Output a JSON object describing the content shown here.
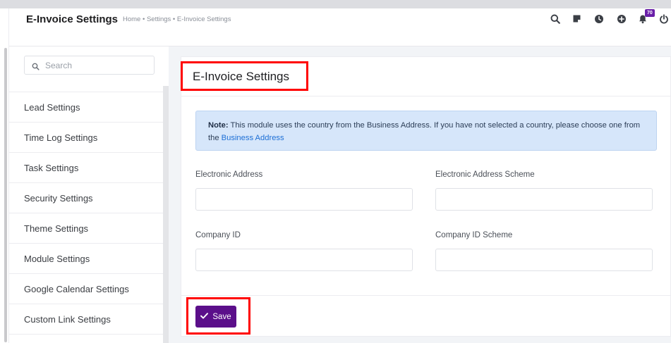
{
  "header": {
    "title": "E-Invoice Settings",
    "breadcrumb": "Home • Settings • E-Invoice Settings",
    "notification_count": "70",
    "icons": [
      "search-icon",
      "sticky-note-icon",
      "clock-icon",
      "plus-circle-icon",
      "bell-icon",
      "power-icon"
    ]
  },
  "sidebar": {
    "search_placeholder": "Search",
    "items": [
      {
        "label": "Lead Settings"
      },
      {
        "label": "Time Log Settings"
      },
      {
        "label": "Task Settings"
      },
      {
        "label": "Security Settings"
      },
      {
        "label": "Theme Settings"
      },
      {
        "label": "Module Settings"
      },
      {
        "label": "Google Calendar Settings"
      },
      {
        "label": "Custom Link Settings"
      }
    ]
  },
  "main": {
    "card_title": "E-Invoice Settings",
    "note": {
      "prefix": "Note:",
      "text": " This module uses the country from the Business Address. If you have not selected a country, please choose one from the ",
      "link": "Business Address"
    },
    "fields": {
      "electronic_address": {
        "label": "Electronic Address",
        "value": ""
      },
      "electronic_address_scheme": {
        "label": "Electronic Address Scheme",
        "value": ""
      },
      "company_id": {
        "label": "Company ID",
        "value": ""
      },
      "company_id_scheme": {
        "label": "Company ID Scheme",
        "value": ""
      }
    },
    "save_label": "Save"
  },
  "colors": {
    "accent": "#5b0f8a",
    "badge": "#6a1fa8",
    "note_bg": "#d6e6fa",
    "link": "#1d6fd6",
    "highlight": "#ff0000"
  }
}
